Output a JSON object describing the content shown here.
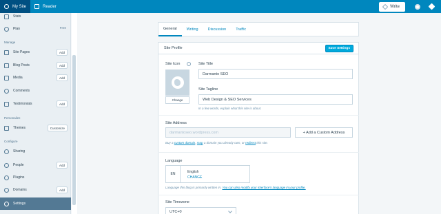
{
  "masterbar": {
    "my_site": "My Site",
    "reader": "Reader",
    "write": "Write"
  },
  "sidebar": {
    "items_top": [
      {
        "label": "Stats",
        "badge": ""
      },
      {
        "label": "Plan",
        "badge": "Free"
      }
    ],
    "heading_manage": "Manage",
    "manage_items": [
      {
        "label": "Site Pages",
        "badge": "Add"
      },
      {
        "label": "Blog Posts",
        "badge": "Add"
      },
      {
        "label": "Media",
        "badge": "Add"
      },
      {
        "label": "Comments",
        "badge": ""
      },
      {
        "label": "Testimonials",
        "badge": "Add"
      }
    ],
    "heading_personalize": "Personalize",
    "personalize_items": [
      {
        "label": "Themes",
        "badge": "Customize"
      }
    ],
    "heading_configure": "Configure",
    "configure_items": [
      {
        "label": "Sharing",
        "badge": ""
      },
      {
        "label": "People",
        "badge": "Add"
      },
      {
        "label": "Plugins",
        "badge": ""
      },
      {
        "label": "Domains",
        "badge": "Add"
      },
      {
        "label": "Settings",
        "badge": ""
      }
    ]
  },
  "tabs": [
    "General",
    "Writing",
    "Discussion",
    "Traffic"
  ],
  "site_profile": {
    "title": "Site Profile",
    "save_label": "Save Settings",
    "site_icon_label": "Site Icon",
    "change_label": "Change",
    "site_title_label": "Site Title",
    "site_title_value": "Darmanto SEO",
    "site_tagline_label": "Site Tagline",
    "site_tagline_value": "Web Design & SEO Services",
    "tagline_hint": "In a few words, explain what this site is about.",
    "site_address_label": "Site Address",
    "site_address_value": "darmantoseo.wordpress.com",
    "add_domain_label": "+ Add a Custom Address",
    "address_hint_1": "Buy a ",
    "address_hint_link1": "custom domain",
    "address_hint_2": ", ",
    "address_hint_link2": "map",
    "address_hint_3": " a domain you already own, or ",
    "address_hint_link3": "redirect",
    "address_hint_4": " this site.",
    "language_label": "Language",
    "language_code": "EN",
    "language_name": "English",
    "language_change": "CHANGE",
    "language_hint_1": "Language this blog is primarily written in. ",
    "language_hint_link": "You can also modify your interface's language in your profile.",
    "timezone_label": "Site Timezone",
    "timezone_value": "UTC+0"
  }
}
